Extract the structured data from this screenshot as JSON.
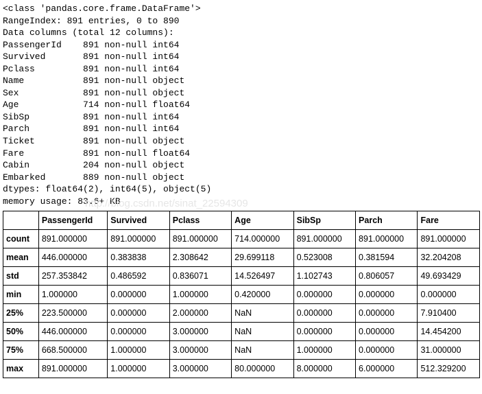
{
  "info": {
    "header": "<class 'pandas.core.frame.DataFrame'>",
    "range": "RangeIndex: 891 entries, 0 to 890",
    "colheader": "Data columns (total 12 columns):",
    "columns": [
      {
        "name": "PassengerId",
        "detail": "891 non-null int64"
      },
      {
        "name": "Survived",
        "detail": "891 non-null int64"
      },
      {
        "name": "Pclass",
        "detail": "891 non-null int64"
      },
      {
        "name": "Name",
        "detail": "891 non-null object"
      },
      {
        "name": "Sex",
        "detail": "891 non-null object"
      },
      {
        "name": "Age",
        "detail": "714 non-null float64"
      },
      {
        "name": "SibSp",
        "detail": "891 non-null int64"
      },
      {
        "name": "Parch",
        "detail": "891 non-null int64"
      },
      {
        "name": "Ticket",
        "detail": "891 non-null object"
      },
      {
        "name": "Fare",
        "detail": "891 non-null float64"
      },
      {
        "name": "Cabin",
        "detail": "204 non-null object"
      },
      {
        "name": "Embarked",
        "detail": "889 non-null object"
      }
    ],
    "dtypes": "dtypes: float64(2), int64(5), object(5)",
    "memory": "memory usage: 83.6+ KB"
  },
  "watermark": "http://blog.csdn.net/sinat_22594309",
  "describe": {
    "columns": [
      "PassengerId",
      "Survived",
      "Pclass",
      "Age",
      "SibSp",
      "Parch",
      "Fare"
    ],
    "rows": [
      {
        "label": "count",
        "cells": [
          "891.000000",
          "891.000000",
          "891.000000",
          "714.000000",
          "891.000000",
          "891.000000",
          "891.000000"
        ]
      },
      {
        "label": "mean",
        "cells": [
          "446.000000",
          "0.383838",
          "2.308642",
          "29.699118",
          "0.523008",
          "0.381594",
          "32.204208"
        ]
      },
      {
        "label": "std",
        "cells": [
          "257.353842",
          "0.486592",
          "0.836071",
          "14.526497",
          "1.102743",
          "0.806057",
          "49.693429"
        ]
      },
      {
        "label": "min",
        "cells": [
          "1.000000",
          "0.000000",
          "1.000000",
          "0.420000",
          "0.000000",
          "0.000000",
          "0.000000"
        ]
      },
      {
        "label": "25%",
        "cells": [
          "223.500000",
          "0.000000",
          "2.000000",
          "NaN",
          "0.000000",
          "0.000000",
          "7.910400"
        ]
      },
      {
        "label": "50%",
        "cells": [
          "446.000000",
          "0.000000",
          "3.000000",
          "NaN",
          "0.000000",
          "0.000000",
          "14.454200"
        ]
      },
      {
        "label": "75%",
        "cells": [
          "668.500000",
          "1.000000",
          "3.000000",
          "NaN",
          "1.000000",
          "0.000000",
          "31.000000"
        ]
      },
      {
        "label": "max",
        "cells": [
          "891.000000",
          "1.000000",
          "3.000000",
          "80.000000",
          "8.000000",
          "6.000000",
          "512.329200"
        ]
      }
    ]
  }
}
